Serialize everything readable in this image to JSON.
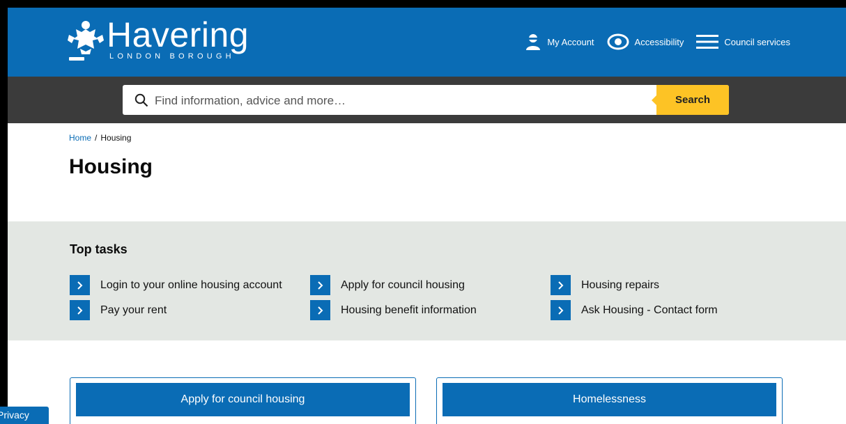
{
  "header": {
    "logo_title": "Havering",
    "logo_subtitle": "LONDON BOROUGH",
    "nav": {
      "my_account": "My Account",
      "accessibility": "Accessibility",
      "council_services": "Council services"
    }
  },
  "search": {
    "placeholder": "Find information, advice and more…",
    "button_label": "Search"
  },
  "breadcrumb": {
    "home": "Home",
    "separator": "/",
    "current": "Housing"
  },
  "page_title": "Housing",
  "top_tasks": {
    "heading": "Top tasks",
    "items": [
      "Login to your online housing account",
      "Apply for council housing",
      "Housing repairs",
      "Pay your rent",
      "Housing benefit information",
      "Ask Housing - Contact form"
    ]
  },
  "cards": [
    "Apply for council housing",
    "Homelessness"
  ],
  "privacy_label": "Privacy",
  "colors": {
    "brand_blue": "#0a6cb5",
    "search_yellow": "#fdc325",
    "dark_band": "#3b3b3b",
    "tasks_bg": "#e3e7e3"
  }
}
